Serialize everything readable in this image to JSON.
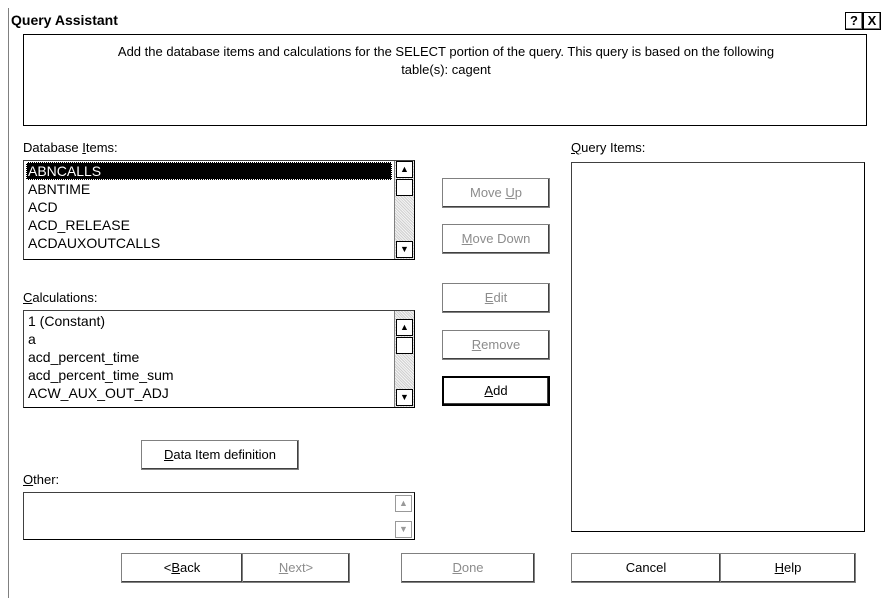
{
  "window": {
    "title": "Query Assistant",
    "help_glyph": "?",
    "close_glyph": "X"
  },
  "description": {
    "line1": "Add the database items and calculations for the SELECT portion of the query. This query is based on the following",
    "line2": "table(s): cagent"
  },
  "database_items": {
    "label_mn": "Database ",
    "label_u": "I",
    "label_rest": "tems:",
    "items": [
      "ABNCALLS",
      "ABNTIME",
      "ACD",
      "ACD_RELEASE",
      "ACDAUXOUTCALLS"
    ],
    "selected": "ABNCALLS"
  },
  "calculations": {
    "label_u": "C",
    "label_rest": "alculations:",
    "items": [
      "1 (Constant)",
      "a",
      "acd_percent_time",
      "acd_percent_time_sum",
      "ACW_AUX_OUT_ADJ"
    ]
  },
  "other": {
    "label_u": "O",
    "label_rest": "ther:",
    "value": ""
  },
  "query_items": {
    "label_u": "Q",
    "label_rest": "uery Items:",
    "items": []
  },
  "buttons": {
    "move_up": {
      "pre": "Move ",
      "u": "U",
      "post": "p"
    },
    "move_down": {
      "pre": "",
      "u": "M",
      "post": "ove Down"
    },
    "edit": {
      "pre": "",
      "u": "E",
      "post": "dit"
    },
    "remove": {
      "pre": "",
      "u": "R",
      "post": "emove"
    },
    "add": {
      "pre": "",
      "u": "A",
      "post": "dd"
    },
    "data_item_definition": {
      "pre": "",
      "u": "D",
      "post": "ata Item definition"
    },
    "back": {
      "pre": "<",
      "u": "B",
      "post": "ack"
    },
    "next": {
      "pre": "",
      "u": "N",
      "post": "ext>"
    },
    "done": {
      "pre": "",
      "u": "D",
      "post": "one"
    },
    "cancel": {
      "pre": "Cancel",
      "u": "",
      "post": ""
    },
    "help": {
      "pre": "",
      "u": "H",
      "post": "elp"
    }
  },
  "icons": {
    "scroll_up": "▲",
    "scroll_down": "▼"
  }
}
